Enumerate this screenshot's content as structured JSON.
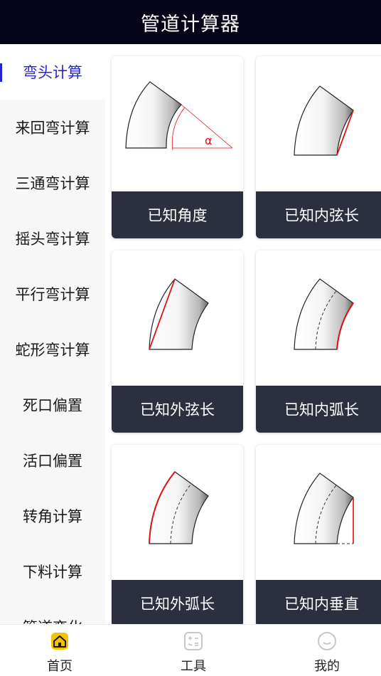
{
  "header": {
    "title": "管道计算器"
  },
  "sidebar": {
    "items": [
      {
        "label": "弯头计算",
        "active": true
      },
      {
        "label": "来回弯计算"
      },
      {
        "label": "三通弯计算"
      },
      {
        "label": "摇头弯计算"
      },
      {
        "label": "平行弯计算"
      },
      {
        "label": "蛇形弯计算"
      },
      {
        "label": "死口偏置"
      },
      {
        "label": "活口偏置"
      },
      {
        "label": "转角计算"
      },
      {
        "label": "下料计算"
      },
      {
        "label": "管道变化"
      }
    ]
  },
  "cards": [
    {
      "label": "已知角度",
      "angle_symbol": "α",
      "highlight": "angle"
    },
    {
      "label": "已知内弦长",
      "highlight": "inner-chord"
    },
    {
      "label": "已知外弦长",
      "highlight": "outer-chord"
    },
    {
      "label": "已知内弧长",
      "highlight": "inner-arc"
    },
    {
      "label": "已知外弧长",
      "highlight": "outer-arc"
    },
    {
      "label": "已知内垂直",
      "highlight": "inner-vertical"
    }
  ],
  "tabbar": {
    "items": [
      {
        "label": "首页",
        "icon": "home-icon",
        "active": true
      },
      {
        "label": "工具",
        "icon": "calculator-icon"
      },
      {
        "label": "我的",
        "icon": "profile-icon"
      }
    ]
  },
  "colors": {
    "header_bg": "#07051a",
    "accent": "#2525cc",
    "highlight": "#e01010",
    "card_label_bg": "#2c2f3e",
    "home_icon": "#f2c400"
  }
}
